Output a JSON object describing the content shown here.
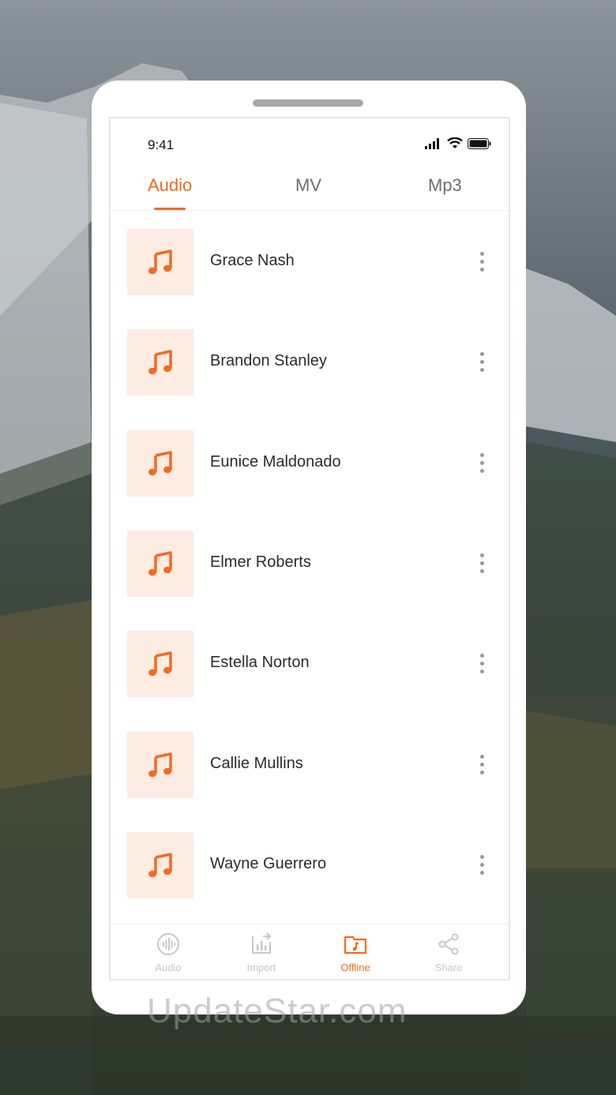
{
  "status_bar": {
    "time": "9:41"
  },
  "tabs": [
    {
      "label": "Audio",
      "active": true
    },
    {
      "label": "MV",
      "active": false
    },
    {
      "label": "Mp3",
      "active": false
    }
  ],
  "tracks": [
    {
      "name": "Grace Nash"
    },
    {
      "name": "Brandon Stanley"
    },
    {
      "name": "Eunice Maldonado"
    },
    {
      "name": "Elmer Roberts"
    },
    {
      "name": "Estella Norton"
    },
    {
      "name": "Callie Mullins"
    },
    {
      "name": "Wayne Guerrero"
    }
  ],
  "bottom_nav": [
    {
      "label": "Audio",
      "icon": "waveform-icon",
      "active": false
    },
    {
      "label": "Import",
      "icon": "import-chart-icon",
      "active": false
    },
    {
      "label": "Offline",
      "icon": "music-folder-icon",
      "active": true
    },
    {
      "label": "Share",
      "icon": "share-icon",
      "active": false
    }
  ],
  "colors": {
    "accent": "#f26b21",
    "thumb_bg": "#fdece2"
  },
  "watermark": "UpdateStar.com"
}
